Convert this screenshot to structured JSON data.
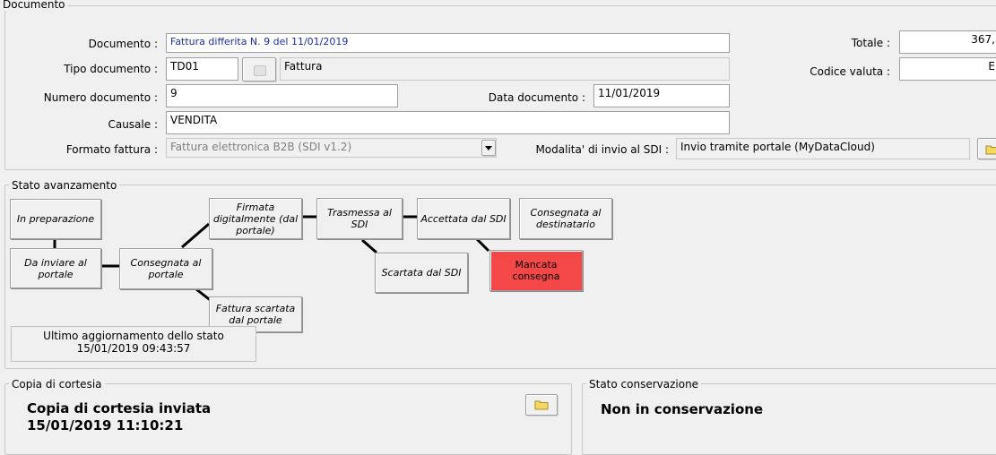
{
  "documento": {
    "legend": "Documento",
    "documento_label": "Documento :",
    "documento_value": "Fattura differita N. 9 del 11/01/2019",
    "tipo_label": "Tipo documento :",
    "tipo_code": "TD01",
    "tipo_desc": "Fattura",
    "numero_label": "Numero documento :",
    "numero_value": "9",
    "data_label": "Data documento :",
    "data_value": "11/01/2019",
    "causale_label": "Causale :",
    "causale_value": "VENDITA",
    "formato_label": "Formato fattura :",
    "formato_value": "Fattura elettronica B2B (SDI v1.2)",
    "modalita_label": "Modalita' di invio al SDI :",
    "modalita_value": "Invio tramite portale (MyDataCloud)",
    "totale_label": "Totale :",
    "totale_value": "367,",
    "valuta_label": "Codice valuta :",
    "valuta_value": "E"
  },
  "stato": {
    "legend": "Stato avanzamento",
    "steps": {
      "in_preparazione": "In preparazione",
      "da_inviare": "Da inviare al portale",
      "consegnata_portale": "Consegnata al portale",
      "firmata": "Firmata digitalmente (dal portale)",
      "scartata_portale": "Fattura scartata dal portale",
      "trasmessa": "Trasmessa al SDI",
      "scartata_sdi": "Scartata dal SDI",
      "accettata": "Accettata dal SDI",
      "mancata": "Mancata consegna",
      "consegnata_dest": "Consegnata al destinatario"
    },
    "update_line1": "Ultimo aggiornamento dello stato",
    "update_line2": "15/01/2019 09:43:57",
    "highlight_color": "#f44848"
  },
  "cortesia": {
    "legend": "Copia di cortesia",
    "line1": "Copia di cortesia inviata",
    "line2": "15/01/2019 11:10:21"
  },
  "conservazione": {
    "legend": "Stato conservazione",
    "value": "Non in conservazione"
  }
}
